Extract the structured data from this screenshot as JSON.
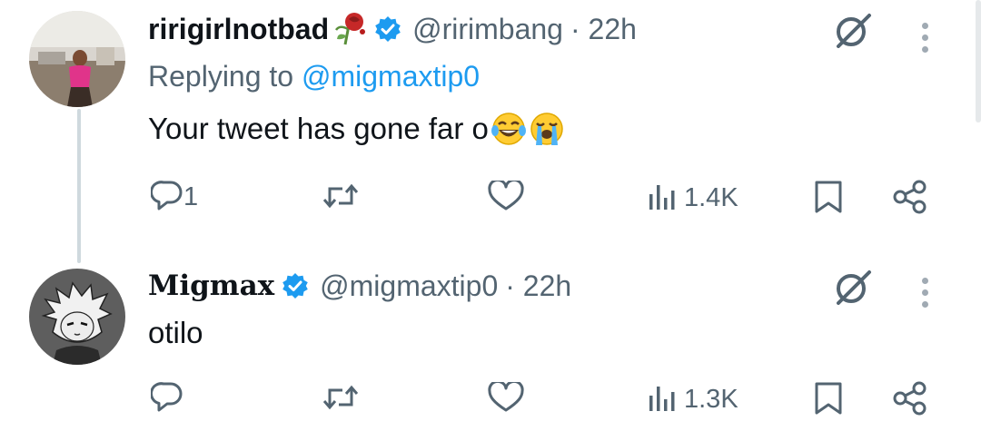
{
  "tweets": [
    {
      "display_name": "ririgirlnotbad",
      "handle": "@ririmbang",
      "time": "· 22h",
      "reply_prefix": "Replying to ",
      "reply_mention": "@migmaxtip0",
      "text": "Your tweet has gone far o",
      "emojis": [
        "joy-emoji",
        "crying-emoji"
      ],
      "stats": {
        "replies": "1",
        "retweets": "",
        "likes": "",
        "views": "1.4K"
      }
    },
    {
      "display_name": "Migmax",
      "handle": "@migmaxtip0",
      "time": "· 22h",
      "text": "otilo",
      "stats": {
        "replies": "",
        "retweets": "",
        "likes": "",
        "views": "1.3K"
      }
    }
  ],
  "colors": {
    "verified": "#1d9bf0",
    "secondary_text": "#536471",
    "primary_text": "#0f1419",
    "thread_line": "#cfd9de"
  },
  "icons": [
    "reply-icon",
    "retweet-icon",
    "like-icon",
    "views-icon",
    "bookmark-icon",
    "share-icon",
    "grok-icon",
    "more-icon",
    "verified-icon",
    "wilted-rose-icon"
  ]
}
